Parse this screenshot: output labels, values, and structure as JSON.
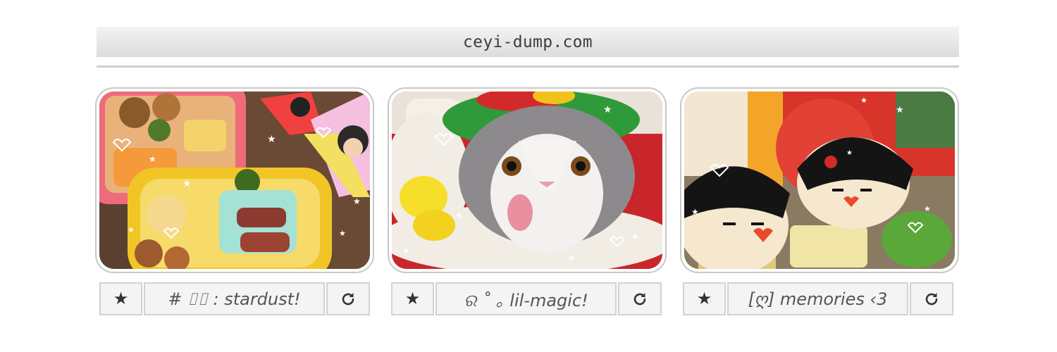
{
  "site": {
    "url": "ceyi-dump.com"
  },
  "cards": [
    {
      "image": "bento-lunchbox-photo",
      "star_icon": "★",
      "label": "# ⌷⌷ : stardust!",
      "reload_icon": "reload-icon"
    },
    {
      "image": "cat-in-christmas-hat-photo",
      "star_icon": "★",
      "label": "ର ˚ ｡ lil-magic!",
      "reload_icon": "reload-icon"
    },
    {
      "image": "plush-dolls-photo",
      "star_icon": "★",
      "label": "[ღ] memories ‹3",
      "reload_icon": "reload-icon"
    }
  ]
}
